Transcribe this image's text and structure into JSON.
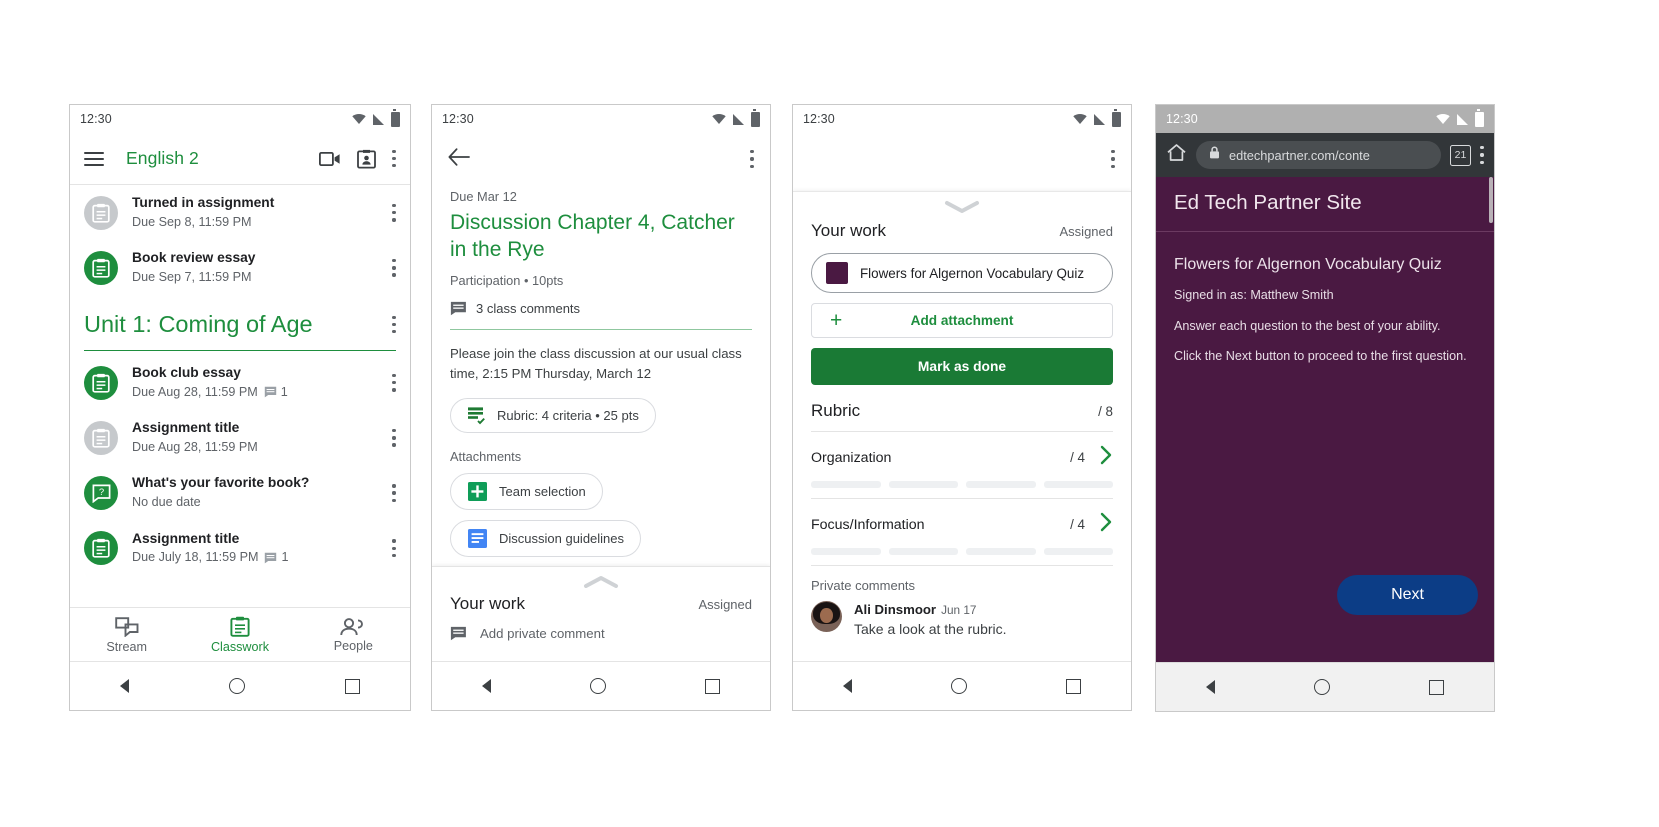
{
  "screens": {
    "classwork": {
      "status": {
        "time": "12:30"
      },
      "appbar": {
        "title": "English 2",
        "menu_icon": "hamburger-icon",
        "meet_icon": "video-camera-icon",
        "folder_icon": "class-drive-icon",
        "overflow_icon": "kebab-icon"
      },
      "top_items": [
        {
          "title": "Turned in assignment",
          "subtitle": "Due Sep 8, 11:59 PM",
          "icon": "assignment-icon",
          "state": "grey",
          "comments": ""
        },
        {
          "title": "Book review essay",
          "subtitle": "Due Sep 7, 11:59 PM",
          "icon": "assignment-icon",
          "state": "green",
          "comments": ""
        }
      ],
      "unit": {
        "title": "Unit 1: Coming of Age"
      },
      "unit_items": [
        {
          "title": "Book club essay",
          "subtitle": "Due Aug 28, 11:59 PM",
          "icon": "assignment-icon",
          "state": "green",
          "comments": "1"
        },
        {
          "title": "Assignment title",
          "subtitle": "Due Aug 28, 11:59 PM",
          "icon": "assignment-icon",
          "state": "grey",
          "comments": ""
        },
        {
          "title": "What's your favorite book?",
          "subtitle": "No due date",
          "icon": "question-icon",
          "state": "green",
          "comments": ""
        },
        {
          "title": "Assignment title",
          "subtitle": "Due July 18, 11:59 PM",
          "icon": "assignment-icon",
          "state": "green",
          "comments": "1"
        }
      ],
      "bottom_nav": [
        {
          "label": "Stream",
          "icon": "stream-icon",
          "active": false
        },
        {
          "label": "Classwork",
          "icon": "classwork-icon",
          "active": true
        },
        {
          "label": "People",
          "icon": "people-icon",
          "active": false
        }
      ]
    },
    "detail": {
      "status": {
        "time": "12:30"
      },
      "back_icon": "back-arrow-icon",
      "overflow_icon": "kebab-icon",
      "due": "Due Mar 12",
      "title": "Discussion Chapter 4, Catcher in the Rye",
      "meta": "Participation • 10pts",
      "class_comments": "3 class comments",
      "body": "Please join the class discussion at our usual class time, 2:15 PM Thursday, March 12",
      "rubric_chip": {
        "label": "Rubric: 4 criteria • 25 pts",
        "icon": "rubric-icon"
      },
      "attachments_label": "Attachments",
      "attachments": [
        {
          "label": "Team selection",
          "icon": "google-sheets-icon",
          "color": "#0f9d58"
        },
        {
          "label": "Discussion guidelines",
          "icon": "google-docs-icon",
          "color": "#4285f4"
        }
      ],
      "sheet": {
        "title": "Your work",
        "status": "Assigned",
        "private_comment_placeholder": "Add private comment",
        "comment_icon": "comment-icon",
        "grabber_icon": "chevron-up-icon"
      }
    },
    "work": {
      "status": {
        "time": "12:30"
      },
      "overflow_icon": "kebab-icon",
      "grabber_icon": "chevron-down-icon",
      "title": "Your work",
      "state": "Assigned",
      "attachment": {
        "label": "Flowers for Algernon Vocabulary Quiz",
        "icon": "quiz-thumbnail-icon",
        "color": "#4a1942"
      },
      "add_attachment": {
        "label": "Add attachment",
        "icon": "plus-icon"
      },
      "mark_done": "Mark as done",
      "rubric": {
        "title": "Rubric",
        "points": "/ 8"
      },
      "criteria": [
        {
          "name": "Organization",
          "points": "/ 4",
          "levels": 4,
          "chevron": "chevron-right-icon"
        },
        {
          "name": "Focus/Information",
          "points": "/ 4",
          "levels": 4,
          "chevron": "chevron-right-icon"
        }
      ],
      "private_comments_label": "Private comments",
      "comments": [
        {
          "author": "Ali Dinsmoor",
          "date": "Jun 17",
          "text": "Take a look at the rubric.",
          "avatar": "user-avatar"
        }
      ]
    },
    "browser": {
      "status": {
        "time": "12:30"
      },
      "home_icon": "home-icon",
      "lock_icon": "lock-icon",
      "url": "edtechpartner.com/conte",
      "tab_count": "21",
      "overflow_icon": "kebab-icon",
      "site_header": "Ed Tech Partner Site",
      "quiz_title": "Flowers for Algernon Vocabulary Quiz",
      "lines": [
        "Signed in as: Matthew Smith",
        "Answer each question to the best of your ability.",
        "Click the Next button to proceed to the first question."
      ],
      "next_label": "Next",
      "theme_color": "#4a1942",
      "button_color": "#0c3d86"
    }
  },
  "android_nav": {
    "back": "back-triangle-icon",
    "home": "home-circle-icon",
    "recents": "recents-square-icon"
  }
}
